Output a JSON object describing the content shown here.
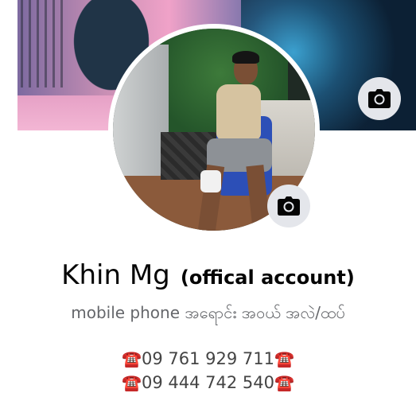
{
  "profile": {
    "name": "Khin Mg",
    "name_suffix": "(offical account)",
    "bio": "mobile phone အရောင်း အဝယ် အလဲ/ထပ်",
    "phones": [
      {
        "left_icon": "☎️",
        "number": "09 761 929 711",
        "right_icon": "☎️"
      },
      {
        "left_icon": "☎️",
        "number": "09 444 742 540",
        "right_icon": "☎️"
      }
    ]
  },
  "icons": {
    "cover_camera": "camera-icon",
    "avatar_camera": "camera-icon",
    "phone": "telephone-icon"
  },
  "colors": {
    "camera_button_bg": "#e4e6eb",
    "name_text": "#050505",
    "bio_text": "#65676b",
    "telephone_red": "#d4302a"
  }
}
